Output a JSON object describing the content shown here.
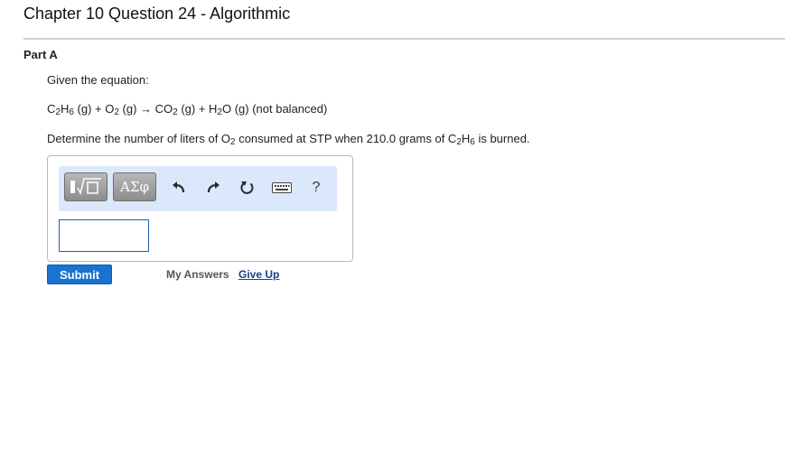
{
  "header": {
    "title": "Chapter 10 Question 24 - Algorithmic"
  },
  "part": {
    "label": "Part A"
  },
  "question": {
    "intro": "Given the equation:",
    "equation": [
      {
        "t": "C"
      },
      {
        "t": "2",
        "sub": true
      },
      {
        "t": "H"
      },
      {
        "t": "6",
        "sub": true
      },
      {
        "t": " (g) + O"
      },
      {
        "t": "2",
        "sub": true
      },
      {
        "t": " (g) → CO"
      },
      {
        "t": "2",
        "sub": true
      },
      {
        "t": " (g) + H"
      },
      {
        "t": "2",
        "sub": true
      },
      {
        "t": "O (g) (not balanced)"
      }
    ],
    "prompt": [
      {
        "t": "Determine the number of liters of O"
      },
      {
        "t": "2",
        "sub": true
      },
      {
        "t": " consumed at STP when 210.0 grams of C"
      },
      {
        "t": "2",
        "sub": true
      },
      {
        "t": "H"
      },
      {
        "t": "6",
        "sub": true
      },
      {
        "t": " is burned."
      }
    ]
  },
  "toolbar": {
    "symbols_label": "ΑΣφ",
    "help_label": "?",
    "icons": [
      "templates-icon",
      "undo-icon",
      "redo-icon",
      "reset-icon",
      "keyboard-icon",
      "help-icon"
    ]
  },
  "answer": {
    "value": ""
  },
  "actions": {
    "submit_label": "Submit",
    "my_answers_label": "My Answers",
    "give_up_label": "Give Up"
  },
  "colors": {
    "toolbar_bg": "#dbe8fb",
    "submit_bg": "#1a73d1",
    "link": "#1a3f8e"
  }
}
